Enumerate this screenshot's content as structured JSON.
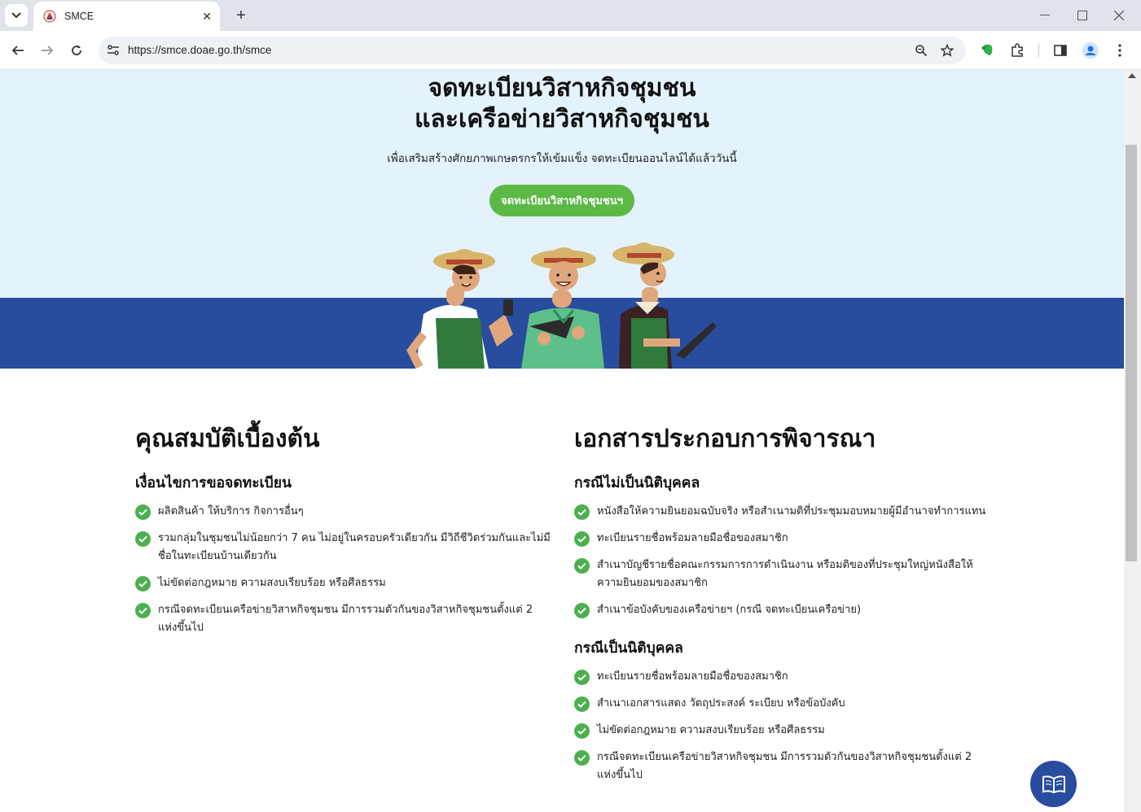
{
  "browser": {
    "tab_title": "SMCE",
    "tab_close": "✕",
    "new_tab": "+",
    "url": "https://smce.doae.go.th/smce",
    "icons": [
      "tab-search-icon",
      "back-icon",
      "forward-icon",
      "reload-icon",
      "site-info-icon",
      "zoom-icon",
      "bookmark-star-icon",
      "evernote-icon",
      "extensions-icon",
      "side-panel-icon",
      "profile-icon",
      "menu-icon"
    ],
    "window_controls": {
      "minimize": "—",
      "maximize": "☐",
      "close": "✕"
    }
  },
  "hero": {
    "title_line1": "จดทะเบียนวิสาหกิจชุมชน",
    "title_line2": "และเครือข่ายวิสาหกิจชุมชน",
    "subtitle": "เพื่อเสริมสร้างศักยภาพเกษตรกรให้เข้มแข็ง จดทะเบียนออนไลน์ได้แล้ววันนี้",
    "cta_label": "จดทะเบียนวิสาหกิจชุมชนฯ",
    "illustration": "three-farmers-illustration"
  },
  "qualifications": {
    "heading": "คุณสมบัติเบื้องต้น",
    "subheading": "เงื่อนไขการขอจดทะเบียน",
    "items": [
      "ผลิตสินค้า ให้บริการ กิจการอื่นๆ",
      "รวมกลุ่มในชุมชนไม่น้อยกว่า 7 คน ไม่อยู่ในครอบครัวเดียวกัน มีวิถีชีวิตร่วมกันและไม่มีชื่อในทะเบียนบ้านเดียวกัน",
      "ไม่ขัดต่อกฎหมาย ความสงบเรียบร้อย หรือศีลธรรม",
      "กรณีจดทะเบียนเครือข่ายวิสาหกิจชุมชน มีการรวมตัวกันของวิสาหกิจชุมชนตั้งแต่ 2 แห่งขึ้นไป"
    ]
  },
  "documents": {
    "heading": "เอกสารประกอบการพิจารณา",
    "non_juristic": {
      "subheading": "กรณีไม่เป็นนิติบุคคล",
      "items": [
        "หนังสือให้ความยินยอมฉบับจริง หรือสำเนามติที่ประชุมมอบหมายผู้มีอำนาจทำการแทน",
        "ทะเบียนรายชื่อพร้อมลายมือชื่อของสมาชิก",
        "สำเนาบัญชีรายชื่อคณะกรรมการการดำเนินงาน หรือมติของที่ประชุมใหญ่หนังสือให้ความยินยอมของสมาชิก",
        "สำเนาข้อบังคับของเครือข่ายฯ (กรณี จดทะเบียนเครือข่าย)"
      ]
    },
    "juristic": {
      "subheading": "กรณีเป็นนิติบุคคล",
      "items": [
        "ทะเบียนรายชื่อพร้อมลายมือชื่อของสมาชิก",
        "สำเนาเอกสารแสดง วัตถุประสงค์ ระเบียบ หรือข้อบังคับ",
        "ไม่ขัดต่อกฎหมาย ความสงบเรียบร้อย หรือศีลธรรม",
        "กรณีจดทะเบียนเครือข่ายวิสาหกิจชุมชน มีการรวมตัวกันของวิสาหกิจชุมชนตั้งแต่ 2 แห่งขึ้นไป"
      ]
    }
  },
  "floating_button": {
    "icon": "open-book-icon"
  },
  "colors": {
    "hero_bg": "#e4f2fb",
    "band": "#284c9e",
    "cta": "#5cb946",
    "check": "#4caf50"
  }
}
